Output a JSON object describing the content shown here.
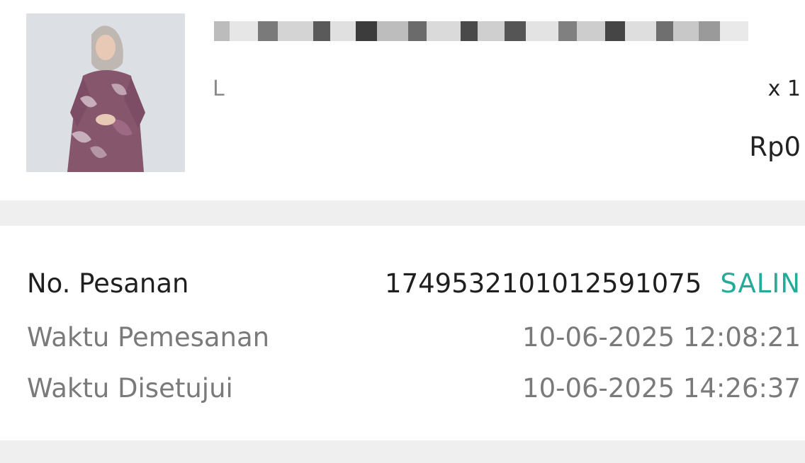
{
  "product": {
    "image_icon": "product-photo-model-in-purple-batik-dress",
    "variant": "L",
    "quantity": "x 1",
    "price": "Rp0"
  },
  "order": {
    "order_no_label": "No. Pesanan",
    "order_no_value": "1749532101012591075",
    "copy_label": "SALIN",
    "order_time_label": "Waktu Pemesanan",
    "order_time_value": "10-06-2025 12:08:21",
    "approved_time_label": "Waktu Disetujui",
    "approved_time_value": "10-06-2025 14:26:37"
  },
  "colors": {
    "accent": "#26aa99",
    "separator": "#efefef",
    "muted_text": "#7a7a7a",
    "primary_text": "#1f1f1f"
  }
}
